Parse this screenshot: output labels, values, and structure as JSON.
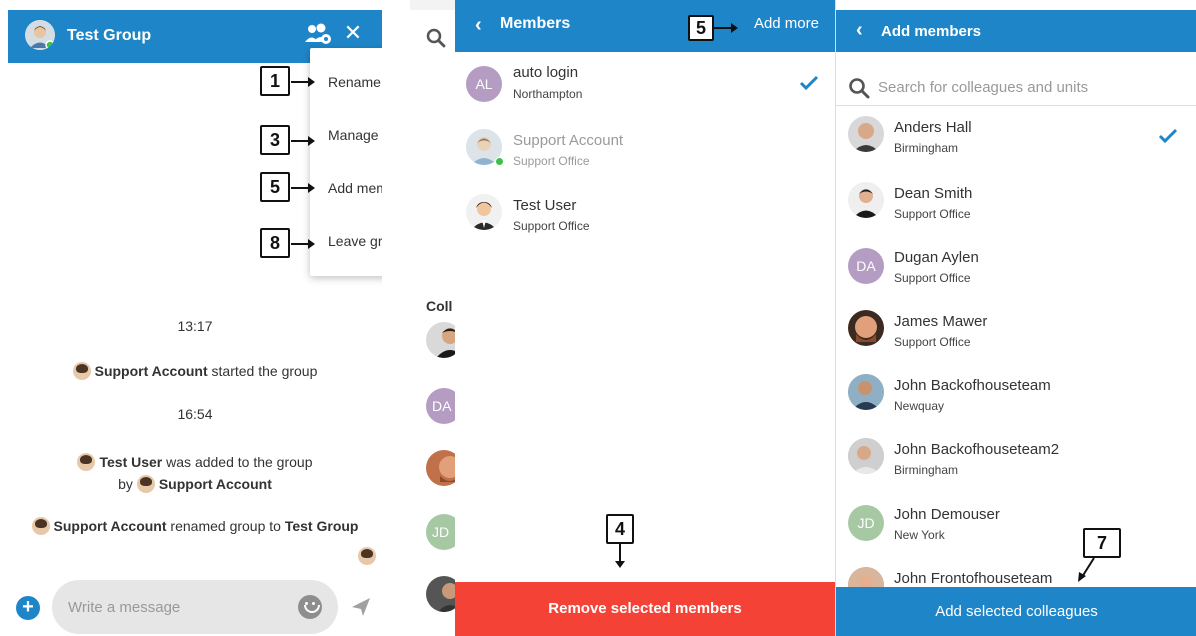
{
  "chat": {
    "title": "Test Group",
    "menu": [
      "Rename group",
      "Manage members",
      "Add member",
      "Leave group"
    ],
    "messages": {
      "time1": "13:17",
      "started_by": "Support Account",
      "started_text": "started the group",
      "time2": "16:54",
      "added_user": "Test User",
      "added_text": "was added to the group",
      "added_by_prefix": "by",
      "added_by": "Support Account",
      "renamed_by": "Support Account",
      "renamed_text": "renamed group to",
      "renamed_to": "Test Group"
    },
    "composer": {
      "placeholder": "Write a message"
    }
  },
  "callouts": {
    "c1": "1",
    "c3": "3",
    "c5a": "5",
    "c8": "8",
    "c5b": "5",
    "c4": "4",
    "c7": "7"
  },
  "strip": {
    "label": "Coll",
    "initials": [
      "DA",
      "JD"
    ]
  },
  "members": {
    "title": "Members",
    "add_more": "Add more",
    "items": [
      {
        "initials": "AL",
        "name": "auto login",
        "location": "Northampton",
        "selected": true
      },
      {
        "name": "Support Account",
        "location": "Support Office",
        "selected": false,
        "online": true
      },
      {
        "name": "Test User",
        "location": "Support Office",
        "selected": false
      }
    ],
    "remove_button": "Remove selected members"
  },
  "add_members": {
    "title": "Add members",
    "search_placeholder": "Search for colleagues and units",
    "items": [
      {
        "name": "Anders Hall",
        "location": "Birmingham",
        "selected": true
      },
      {
        "name": "Dean Smith",
        "location": "Support Office"
      },
      {
        "initials": "DA",
        "name": "Dugan Aylen",
        "location": "Support Office"
      },
      {
        "name": "James Mawer",
        "location": "Support Office"
      },
      {
        "name": "John Backofhouseteam",
        "location": "Newquay"
      },
      {
        "name": "John Backofhouseteam2",
        "location": "Birmingham"
      },
      {
        "initials": "JD",
        "name": "John Demouser",
        "location": "New York"
      },
      {
        "name": "John Frontofhouseteam",
        "location": ""
      }
    ],
    "add_button": "Add selected colleagues"
  },
  "colors": {
    "header_blue": "#1e86c8",
    "remove_red": "#f44336",
    "check_blue": "#1e86c8",
    "initials_purple": "#b59cc2",
    "initials_green": "#a6c9a4"
  }
}
